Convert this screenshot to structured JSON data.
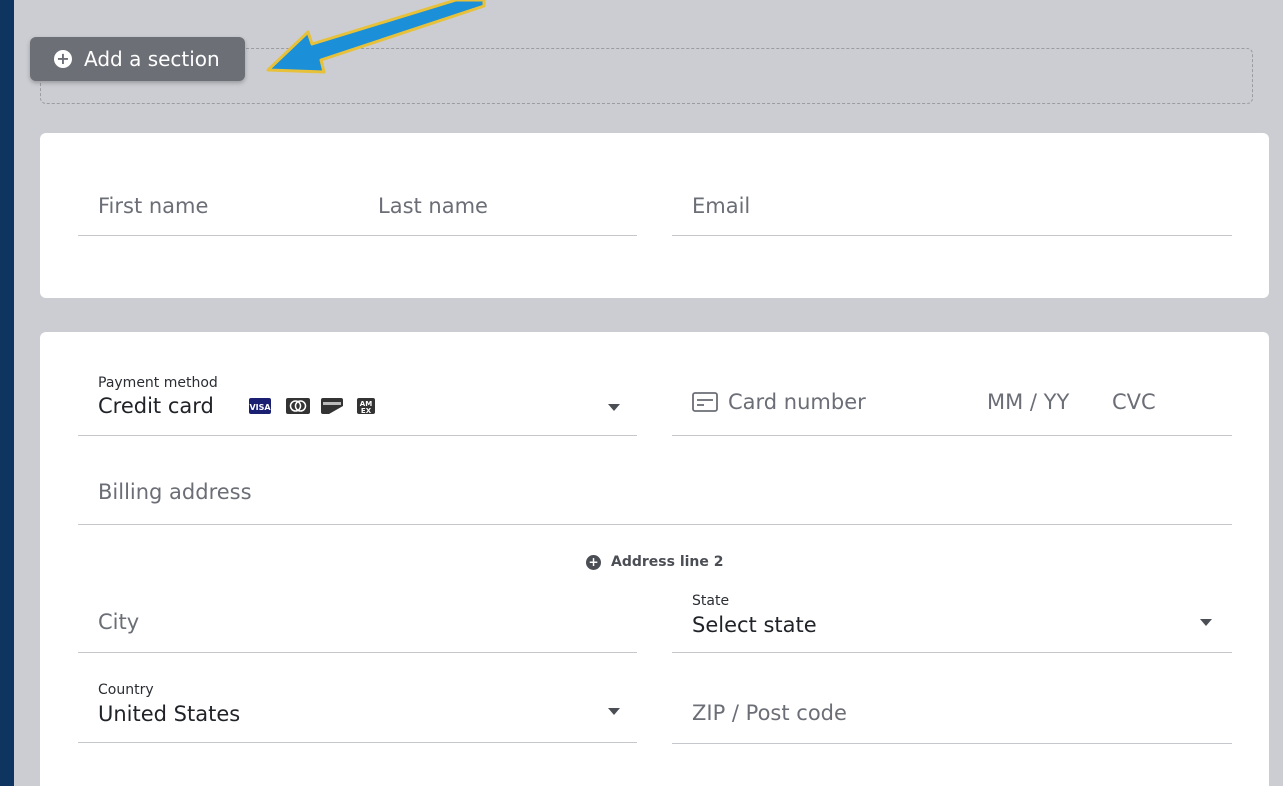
{
  "add_section": {
    "label": "Add a section"
  },
  "contact": {
    "first_name_placeholder": "First name",
    "last_name_placeholder": "Last name",
    "email_placeholder": "Email"
  },
  "payment": {
    "method_label": "Payment method",
    "method_value": "Credit card",
    "card_brands": [
      "visa-icon",
      "mastercard-icon",
      "discover-icon",
      "amex-icon"
    ],
    "card_number_placeholder": "Card number",
    "expiry_placeholder": "MM / YY",
    "cvc_placeholder": "CVC",
    "billing_address_placeholder": "Billing address",
    "address_line2_label": "Address line 2",
    "city_placeholder": "City",
    "state_label": "State",
    "state_value": "Select state",
    "country_label": "Country",
    "country_value": "United States",
    "zip_placeholder": "ZIP / Post code"
  },
  "colors": {
    "frame": "#0d3560",
    "canvas": "#cbcdd2",
    "button": "#6c6f76",
    "arrow": "#1b8fd8",
    "arrow_outline": "#e8c13a"
  }
}
